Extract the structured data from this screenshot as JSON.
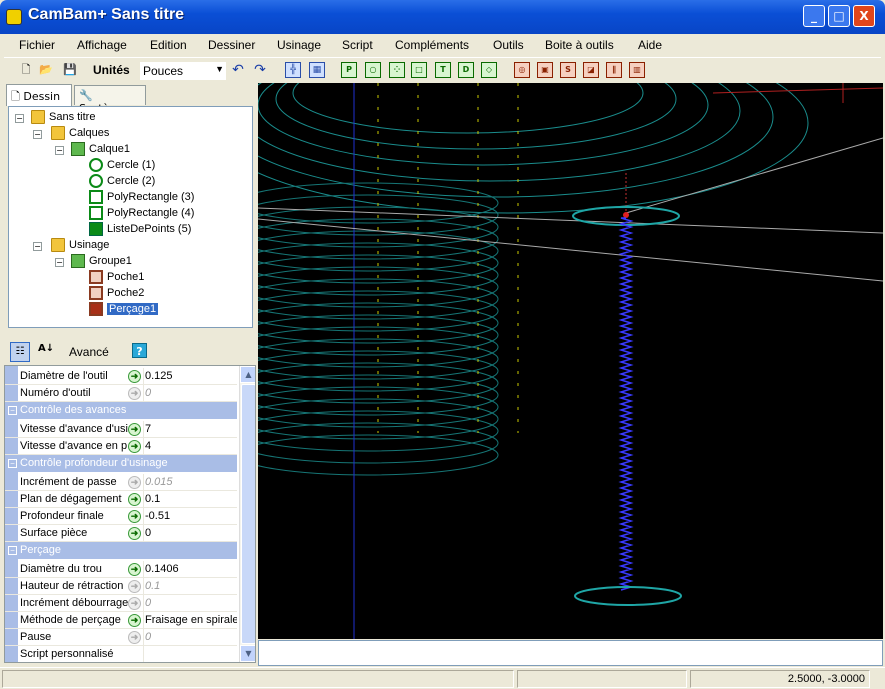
{
  "window": {
    "title": "CamBam+  Sans titre",
    "min_btn": "_",
    "max_btn": "□",
    "close_btn": "X"
  },
  "menu": [
    "Fichier",
    "Affichage",
    "Edition",
    "Dessiner",
    "Usinage",
    "Script",
    "Compléments",
    "Outils",
    "Boite à outils",
    "Aide"
  ],
  "toolbar": {
    "units_label": "Unités",
    "units_value": "Pouces",
    "icons": [
      "new-file-icon",
      "open-folder-icon",
      "save-icon",
      "undo-icon",
      "redo-icon",
      "snap-grid-icon",
      "grid-icon",
      "profile-icon",
      "pocket-icon",
      "drill-icon",
      "poly-icon",
      "text-icon",
      "curve-icon",
      "box-icon",
      "op1-icon",
      "op2-icon",
      "op3-icon",
      "op4-icon",
      "op5-icon",
      "op6-icon"
    ]
  },
  "tabs": [
    {
      "label": "Dessin",
      "icon": "document-icon"
    },
    {
      "label": "Système",
      "icon": "wrench-icon"
    }
  ],
  "tree": {
    "root": "Sans titre",
    "layers_label": "Calques",
    "layer": "Calque1",
    "drawing_items": [
      "Cercle (1)",
      "Cercle (2)",
      "PolyRectangle (3)",
      "PolyRectangle (4)",
      "ListeDePoints (5)"
    ],
    "machining_label": "Usinage",
    "group": "Groupe1",
    "operations": [
      "Poche1",
      "Poche2",
      "Perçage1"
    ],
    "selected": "Perçage1"
  },
  "props_toolbar": {
    "advanced_label": "Avancé",
    "help_label": "?"
  },
  "properties": {
    "tool_diameter": {
      "name": "Diamètre de l'outil",
      "value": "0.125"
    },
    "tool_number": {
      "name": "Numéro d'outil",
      "value": "0"
    },
    "cat_feed": "Contrôle des avances",
    "cut_feedrate": {
      "name": "Vitesse d'avance d'usi",
      "value": "7"
    },
    "plunge_feedrate": {
      "name": "Vitesse d'avance en p",
      "value": "4"
    },
    "cat_depth": "Contrôle profondeur d'usinage",
    "depth_increment": {
      "name": "Incrément de passe",
      "value": "0.015"
    },
    "clearance_plane": {
      "name": "Plan de dégagement",
      "value": "0.1"
    },
    "target_depth": {
      "name": "Profondeur finale",
      "value": "-0.51"
    },
    "stock_surface": {
      "name": "Surface pièce",
      "value": "0"
    },
    "cat_drill": "Perçage",
    "hole_diameter": {
      "name": "Diamètre du trou",
      "value": "0.1406"
    },
    "retract_height": {
      "name": "Hauteur de rétraction",
      "value": "0.1"
    },
    "peck_distance": {
      "name": "Incrément débourrage",
      "value": "0"
    },
    "drill_method": {
      "name": "Méthode de perçage",
      "value": "Fraisage en spirale"
    },
    "dwell": {
      "name": "Pause",
      "value": "0"
    },
    "custom_script": {
      "name": "Script personnalisé",
      "value": ""
    }
  },
  "status": {
    "coords": "2.5000, -3.0000"
  },
  "colors": {
    "title_blue": "#0a4fd6",
    "viewport_bg": "#000000",
    "toolpath_cyan": "#1fa6a6",
    "spiral_blue": "#3a3aff",
    "marker_yellow": "#c8c800"
  }
}
